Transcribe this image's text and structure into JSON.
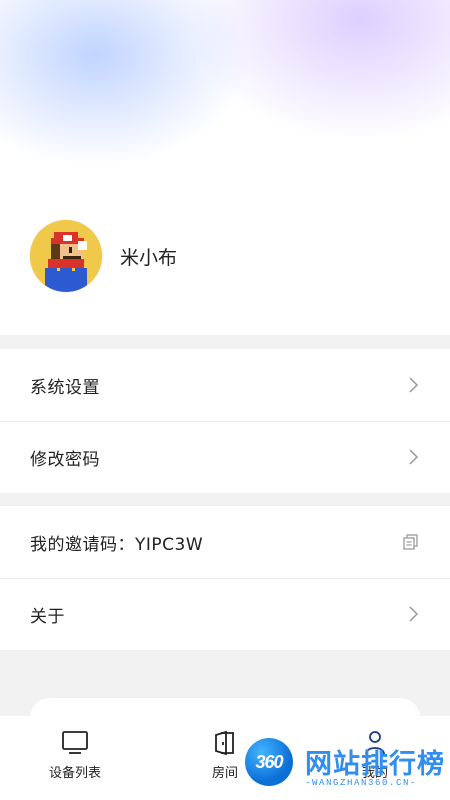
{
  "profile": {
    "username": "米小布"
  },
  "menu_group_1": [
    {
      "label": "系统设置"
    },
    {
      "label": "修改密码"
    }
  ],
  "menu_group_2": {
    "invite_label": "我的邀请码：YIPC3W",
    "about_label": "关于"
  },
  "bottom_nav": {
    "device_list": "设备列表",
    "room": "房间",
    "me": "我的"
  },
  "watermark": {
    "badge": "360",
    "title": "网站排行榜",
    "subtitle": "-WANGZHAN360.CN-"
  },
  "colors": {
    "accent_blue": "#2f8ef0",
    "avatar_bg": "#f0c84a"
  },
  "icons": [
    "tv-icon",
    "door-icon",
    "user-icon",
    "chevron-right-icon",
    "copy-icon"
  ]
}
